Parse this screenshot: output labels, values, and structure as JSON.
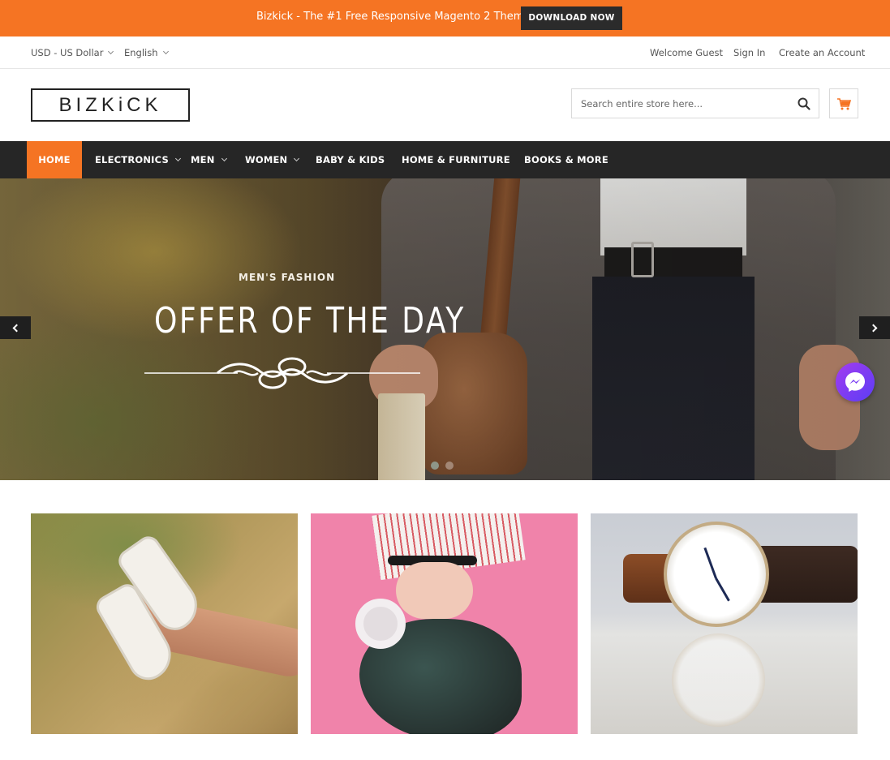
{
  "promo_bar": {
    "text": "Bizkick - The #1 Free Responsive Magento 2 Theme.",
    "button_label": "DOWNLOAD NOW",
    "background_color": "#f57423"
  },
  "utility_bar": {
    "currency": "USD - US Dollar",
    "language": "English",
    "welcome": "Welcome Guest",
    "sign_in": "Sign In",
    "create_account": "Create an Account"
  },
  "header": {
    "logo_text": "BIZKiCK",
    "search_placeholder": "Search entire store here...",
    "search_icon": "search-icon",
    "cart_icon": "cart-icon"
  },
  "nav": {
    "items": [
      {
        "label": "HOME",
        "active": true,
        "has_dropdown": false
      },
      {
        "label": "ELECTRONICS",
        "active": false,
        "has_dropdown": true
      },
      {
        "label": "MEN",
        "active": false,
        "has_dropdown": true
      },
      {
        "label": "WOMEN",
        "active": false,
        "has_dropdown": true
      },
      {
        "label": "BABY & KIDS",
        "active": false,
        "has_dropdown": false
      },
      {
        "label": "HOME & FURNITURE",
        "active": false,
        "has_dropdown": false
      },
      {
        "label": "BOOKS & MORE",
        "active": false,
        "has_dropdown": false
      }
    ],
    "active_color": "#f57423",
    "background_color": "#262626"
  },
  "hero": {
    "subtitle": "MEN'S FASHION",
    "title": "OFFER OF THE DAY",
    "prev_icon": "chevron-left-icon",
    "next_icon": "chevron-right-icon",
    "slides": 2,
    "active_slide": 1
  },
  "messenger": {
    "icon": "messenger-icon"
  },
  "promo_tiles": [
    {
      "subject": "sneakers"
    },
    {
      "subject": "headphones"
    },
    {
      "subject": "wristwatch"
    }
  ]
}
